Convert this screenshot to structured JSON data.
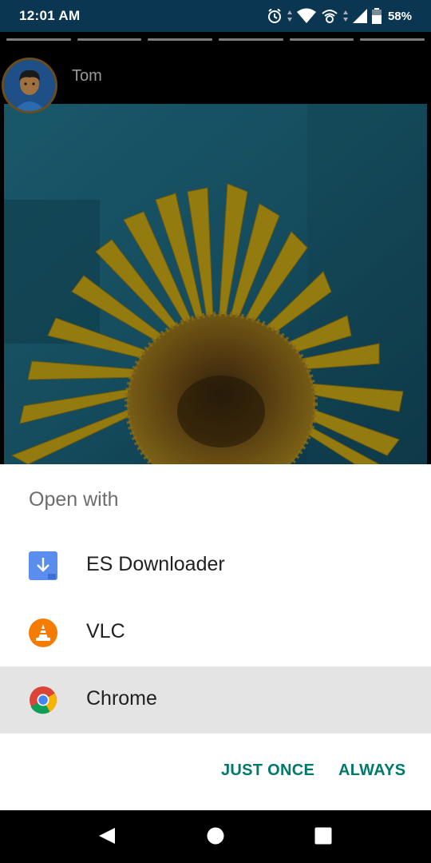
{
  "status_bar": {
    "time": "12:01 AM",
    "battery_percent": "58%",
    "icons": [
      "alarm-icon",
      "wifi-icon",
      "hotspot-icon",
      "signal-icon",
      "battery-icon"
    ]
  },
  "story": {
    "username": "Tom",
    "progress_segments": 6,
    "image_subject": "sunflower"
  },
  "dialog": {
    "title": "Open with",
    "apps": [
      {
        "label": "ES Downloader",
        "icon": "es-downloader-icon",
        "selected": false
      },
      {
        "label": "VLC",
        "icon": "vlc-icon",
        "selected": false
      },
      {
        "label": "Chrome",
        "icon": "chrome-icon",
        "selected": true
      }
    ],
    "just_once_label": "JUST ONCE",
    "always_label": "ALWAYS"
  },
  "colors": {
    "status_bar": "#0b3652",
    "accent": "#00796b",
    "selected_row": "#e4e4e4"
  },
  "nav": {
    "buttons": [
      "back-icon",
      "home-icon",
      "recents-icon"
    ]
  }
}
